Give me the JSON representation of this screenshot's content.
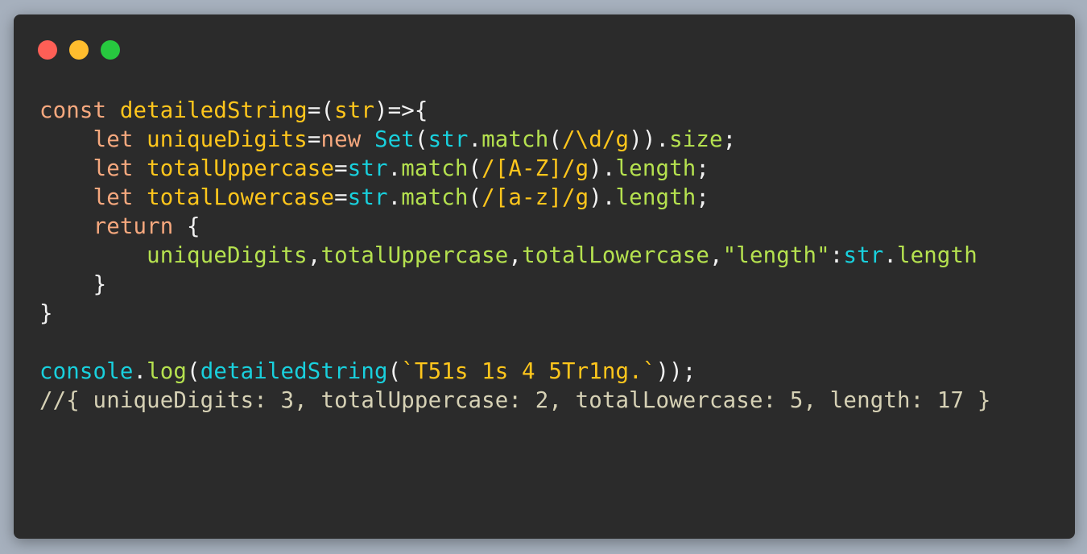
{
  "colors": {
    "page_background": "#a6b0bd",
    "window_background": "#2b2b2b",
    "close": "#ff5f56",
    "minimize": "#ffbd2e",
    "maximize": "#27c93f",
    "keyword": "#f6a87e",
    "definition": "#ffc61c",
    "punctuation": "#f2f2f2",
    "variable": "#19d0dd",
    "property": "#b5e14f",
    "string": "#b5e14f",
    "comment": "#d6d1b5"
  },
  "window_controls": [
    {
      "name": "close",
      "icon": "red-dot"
    },
    {
      "name": "minimize",
      "icon": "yellow-dot"
    },
    {
      "name": "maximize",
      "icon": "green-dot"
    }
  ],
  "code_lines": [
    [
      {
        "text": "const",
        "type": "keyword"
      },
      {
        "text": " ",
        "type": "punct"
      },
      {
        "text": "detailedString",
        "type": "def"
      },
      {
        "text": "=(",
        "type": "punct"
      },
      {
        "text": "str",
        "type": "def"
      },
      {
        "text": ")=>{",
        "type": "punct"
      }
    ],
    [
      {
        "text": "    ",
        "type": "punct"
      },
      {
        "text": "let",
        "type": "keyword"
      },
      {
        "text": " ",
        "type": "punct"
      },
      {
        "text": "uniqueDigits",
        "type": "def"
      },
      {
        "text": "=",
        "type": "punct"
      },
      {
        "text": "new",
        "type": "keyword"
      },
      {
        "text": " ",
        "type": "punct"
      },
      {
        "text": "Set",
        "type": "var"
      },
      {
        "text": "(",
        "type": "punct"
      },
      {
        "text": "str",
        "type": "var"
      },
      {
        "text": ".",
        "type": "punct"
      },
      {
        "text": "match",
        "type": "prop"
      },
      {
        "text": "(",
        "type": "punct"
      },
      {
        "text": "/\\d/g",
        "type": "regex"
      },
      {
        "text": ")).",
        "type": "punct"
      },
      {
        "text": "size",
        "type": "prop"
      },
      {
        "text": ";",
        "type": "punct"
      }
    ],
    [
      {
        "text": "    ",
        "type": "punct"
      },
      {
        "text": "let",
        "type": "keyword"
      },
      {
        "text": " ",
        "type": "punct"
      },
      {
        "text": "totalUppercase",
        "type": "def"
      },
      {
        "text": "=",
        "type": "punct"
      },
      {
        "text": "str",
        "type": "var"
      },
      {
        "text": ".",
        "type": "punct"
      },
      {
        "text": "match",
        "type": "prop"
      },
      {
        "text": "(",
        "type": "punct"
      },
      {
        "text": "/[A-Z]/g",
        "type": "regex"
      },
      {
        "text": ").",
        "type": "punct"
      },
      {
        "text": "length",
        "type": "prop"
      },
      {
        "text": ";",
        "type": "punct"
      }
    ],
    [
      {
        "text": "    ",
        "type": "punct"
      },
      {
        "text": "let",
        "type": "keyword"
      },
      {
        "text": " ",
        "type": "punct"
      },
      {
        "text": "totalLowercase",
        "type": "def"
      },
      {
        "text": "=",
        "type": "punct"
      },
      {
        "text": "str",
        "type": "var"
      },
      {
        "text": ".",
        "type": "punct"
      },
      {
        "text": "match",
        "type": "prop"
      },
      {
        "text": "(",
        "type": "punct"
      },
      {
        "text": "/[a-z]/g",
        "type": "regex"
      },
      {
        "text": ").",
        "type": "punct"
      },
      {
        "text": "length",
        "type": "prop"
      },
      {
        "text": ";",
        "type": "punct"
      }
    ],
    [
      {
        "text": "    ",
        "type": "punct"
      },
      {
        "text": "return",
        "type": "keyword"
      },
      {
        "text": " {",
        "type": "punct"
      }
    ],
    [
      {
        "text": "        ",
        "type": "punct"
      },
      {
        "text": "uniqueDigits",
        "type": "prop"
      },
      {
        "text": ",",
        "type": "punct"
      },
      {
        "text": "totalUppercase",
        "type": "prop"
      },
      {
        "text": ",",
        "type": "punct"
      },
      {
        "text": "totalLowercase",
        "type": "prop"
      },
      {
        "text": ",",
        "type": "punct"
      },
      {
        "text": "\"length\"",
        "type": "string"
      },
      {
        "text": ":",
        "type": "punct"
      },
      {
        "text": "str",
        "type": "var"
      },
      {
        "text": ".",
        "type": "punct"
      },
      {
        "text": "length",
        "type": "prop"
      }
    ],
    [
      {
        "text": "    ",
        "type": "punct"
      },
      {
        "text": "}",
        "type": "punct"
      }
    ],
    [
      {
        "text": "}",
        "type": "punct"
      }
    ],
    [],
    [
      {
        "text": "console",
        "type": "var"
      },
      {
        "text": ".",
        "type": "punct"
      },
      {
        "text": "log",
        "type": "prop"
      },
      {
        "text": "(",
        "type": "punct"
      },
      {
        "text": "detailedString",
        "type": "var"
      },
      {
        "text": "(",
        "type": "punct"
      },
      {
        "text": "`T51s 1s 4 5Tr1ng.`",
        "type": "template"
      },
      {
        "text": "));",
        "type": "punct"
      }
    ],
    [
      {
        "text": "//{ uniqueDigits: 3, totalUppercase: 2, totalLowercase: 5, length: 17 }",
        "type": "comment"
      }
    ]
  ]
}
